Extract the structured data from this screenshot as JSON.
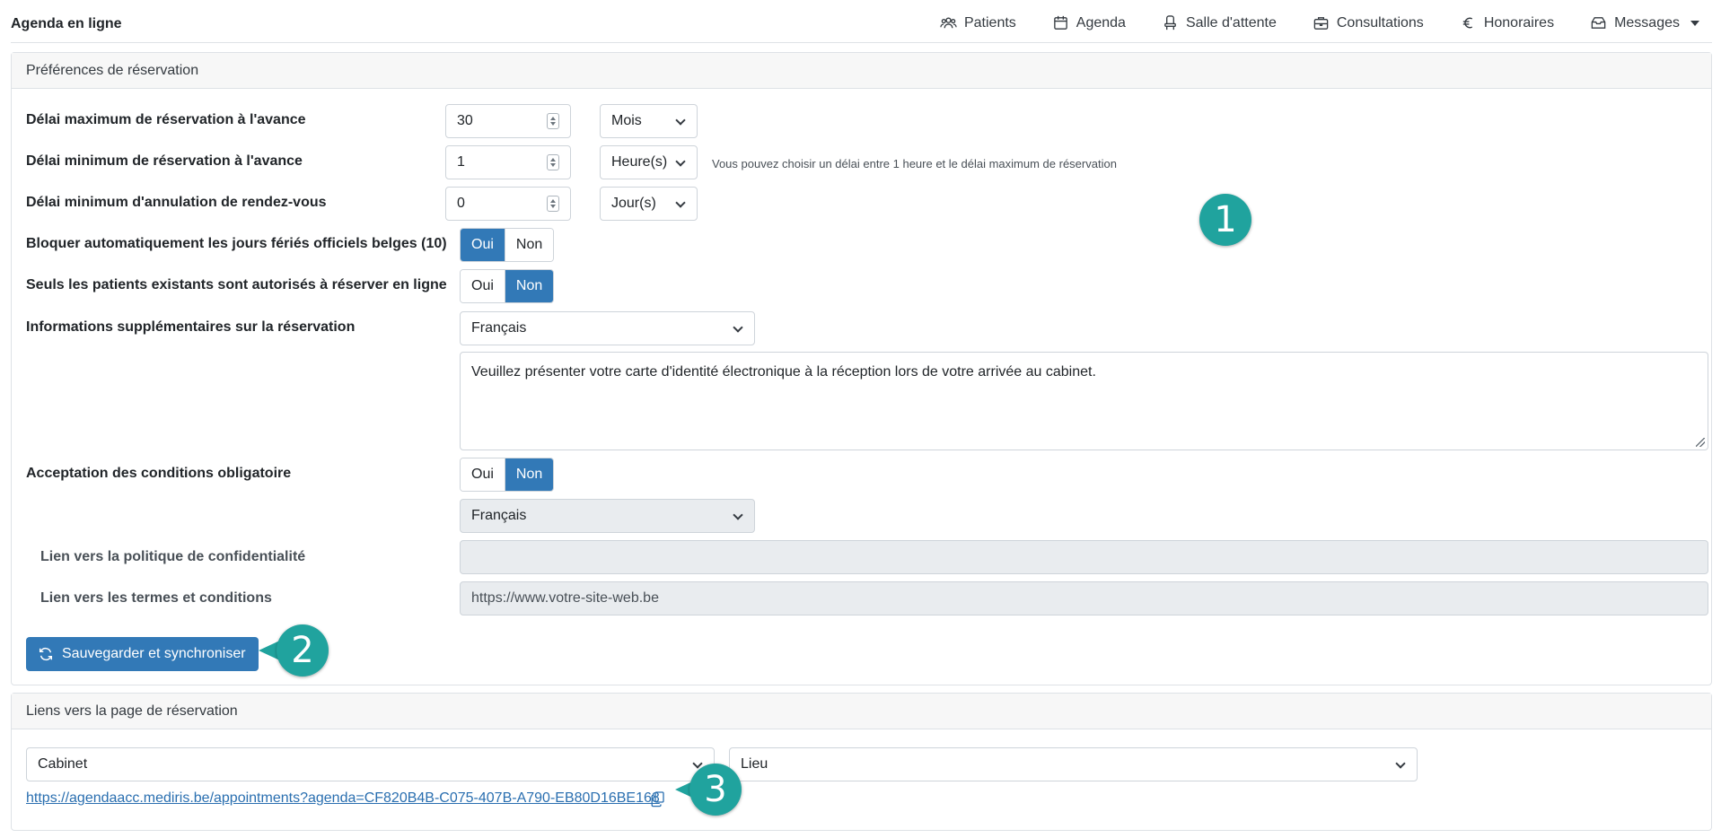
{
  "app": {
    "title": "Agenda en ligne"
  },
  "nav": {
    "items": [
      {
        "label": "Patients",
        "icon": "users-icon"
      },
      {
        "label": "Agenda",
        "icon": "calendar-icon"
      },
      {
        "label": "Salle d'attente",
        "icon": "chair-icon"
      },
      {
        "label": "Consultations",
        "icon": "briefcase-icon"
      },
      {
        "label": "Honoraires",
        "icon": "euro-icon"
      },
      {
        "label": "Messages",
        "icon": "envelope-icon"
      }
    ]
  },
  "prefs": {
    "title": "Préférences de réservation",
    "max_delay": {
      "label": "Délai maximum de réservation à l'avance",
      "value": "30",
      "unit": "Mois"
    },
    "min_delay": {
      "label": "Délai minimum de réservation à l'avance",
      "value": "1",
      "unit": "Heure(s)",
      "help": "Vous pouvez choisir un délai entre 1 heure et le délai maximum de réservation"
    },
    "cancel_delay": {
      "label": "Délai minimum d'annulation de rendez-vous",
      "value": "0",
      "unit": "Jour(s)"
    },
    "holidays": {
      "label": "Bloquer automatiquement les jours fériés officiels belges (10)",
      "yes": "Oui",
      "no": "Non",
      "selected": "yes"
    },
    "existing_only": {
      "label": "Seuls les patients existants sont autorisés à réserver en ligne",
      "yes": "Oui",
      "no": "Non",
      "selected": "no"
    },
    "extra_info": {
      "label": "Informations supplémentaires sur la réservation",
      "language": "Français",
      "text": "Veuillez présenter votre carte d'identité électronique à la réception lors de votre arrivée au cabinet."
    },
    "terms": {
      "label": "Acceptation des conditions obligatoire",
      "yes": "Oui",
      "no": "Non",
      "selected": "no",
      "language": "Français"
    },
    "privacy_link": {
      "label": "Lien vers la politique de confidentialité",
      "value": ""
    },
    "terms_link": {
      "label": "Lien vers les termes et conditions",
      "value": "https://www.votre-site-web.be"
    },
    "save_label": "Sauvegarder et synchroniser"
  },
  "links": {
    "title": "Liens vers la page de réservation",
    "cabinet": "Cabinet",
    "lieu": "Lieu",
    "url": "https://agendaacc.mediris.be/appointments?agenda=CF820B4B-C075-407B-A790-EB80D16BE168"
  },
  "callouts": [
    "1",
    "2",
    "3"
  ],
  "colors": {
    "primary": "#3279b7",
    "callout": "#20a39e",
    "disabled": "#e9ecef"
  }
}
